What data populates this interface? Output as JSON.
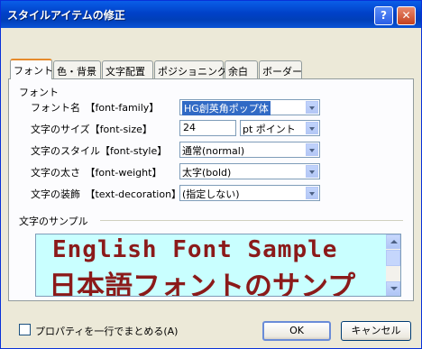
{
  "window": {
    "title": "スタイルアイテムの修正"
  },
  "title_buttons": {
    "help": "?",
    "close": "✕"
  },
  "tabs": [
    "フォント",
    "色・背景",
    "文字配置",
    "ポジショニング",
    "余白",
    "ボーダー"
  ],
  "font_group": {
    "label": "フォント"
  },
  "fields": {
    "family": {
      "label": "フォント名　【font-family】",
      "value": "HG創英角ポップ体"
    },
    "size": {
      "label": "文字のサイズ【font-size】",
      "value": "24",
      "unit": "pt  ポイント"
    },
    "style": {
      "label": "文字のスタイル【font-style】",
      "value": "通常(normal)"
    },
    "weight": {
      "label": "文字の太さ　【font-weight】",
      "value": "太字(bold)"
    },
    "decoration": {
      "label": "文字の装飾　【text-decoration】",
      "value": "(指定しない)"
    }
  },
  "sample_group": {
    "label": "文字のサンプル",
    "english": "English Font Sample",
    "japanese": "日本語フォントのサンプ"
  },
  "footer": {
    "checkbox_label": "プロパティを一行でまとめる(A)",
    "checkbox_checked": false,
    "ok_label": "OK",
    "cancel_label": "キャンセル"
  },
  "colors": {
    "title_bar": "#0a5ee8",
    "sample_background": "#c9ffff",
    "sample_text": "#8b1a1a"
  }
}
